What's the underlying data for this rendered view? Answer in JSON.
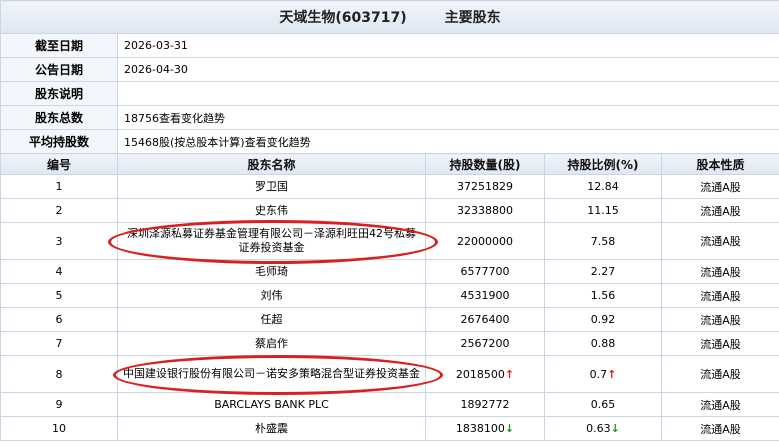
{
  "header": {
    "company": "天域生物(603717)",
    "section": "主要股东"
  },
  "info": [
    {
      "label": "截至日期",
      "value": "2026-03-31",
      "link": ""
    },
    {
      "label": "公告日期",
      "value": "2026-04-30",
      "link": ""
    },
    {
      "label": "股东说明",
      "value": "",
      "link": ""
    },
    {
      "label": "股东总数",
      "value": "18756",
      "link": "查看变化趋势"
    },
    {
      "label": "平均持股数",
      "value": "15468股(按总股本计算)",
      "link": "查看变化趋势"
    }
  ],
  "table": {
    "columns": [
      "编号",
      "股东名称",
      "持股数量(股)",
      "持股比例(%)",
      "股本性质"
    ],
    "rows": [
      {
        "no": "1",
        "name": "罗卫国",
        "shares": "37251829",
        "ratio": "12.84",
        "trend": "",
        "type": "流通A股"
      },
      {
        "no": "2",
        "name": "史东伟",
        "shares": "32338800",
        "ratio": "11.15",
        "trend": "",
        "type": "流通A股"
      },
      {
        "no": "3",
        "name": "深圳泽源私募证券基金管理有限公司－泽源利旺田42号私募证券投资基金",
        "shares": "22000000",
        "ratio": "7.58",
        "trend": "",
        "type": "流通A股"
      },
      {
        "no": "4",
        "name": "毛师琦",
        "shares": "6577700",
        "ratio": "2.27",
        "trend": "",
        "type": "流通A股"
      },
      {
        "no": "5",
        "name": "刘伟",
        "shares": "4531900",
        "ratio": "1.56",
        "trend": "",
        "type": "流通A股"
      },
      {
        "no": "6",
        "name": "任超",
        "shares": "2676400",
        "ratio": "0.92",
        "trend": "",
        "type": "流通A股"
      },
      {
        "no": "7",
        "name": "蔡启作",
        "shares": "2567200",
        "ratio": "0.88",
        "trend": "",
        "type": "流通A股"
      },
      {
        "no": "8",
        "name": "中国建设银行股份有限公司－诺安多策略混合型证券投资基金",
        "shares": "2018500",
        "ratio": "0.7",
        "trend": "up",
        "type": "流通A股"
      },
      {
        "no": "9",
        "name": "BARCLAYS BANK PLC",
        "shares": "1892772",
        "ratio": "0.65",
        "trend": "",
        "type": "流通A股"
      },
      {
        "no": "10",
        "name": "朴盛震",
        "shares": "1838100",
        "ratio": "0.63",
        "trend": "down",
        "type": "流通A股"
      }
    ]
  },
  "colors": {
    "border": "#c9d6e6",
    "header_bg": "#dde6f1",
    "label_bg": "#f3f6fa",
    "up": "#d61f1f",
    "down": "#1e8f2a",
    "annotation": "#d9201e"
  },
  "icons": {
    "up": "arrow-up-icon",
    "down": "arrow-down-icon"
  }
}
